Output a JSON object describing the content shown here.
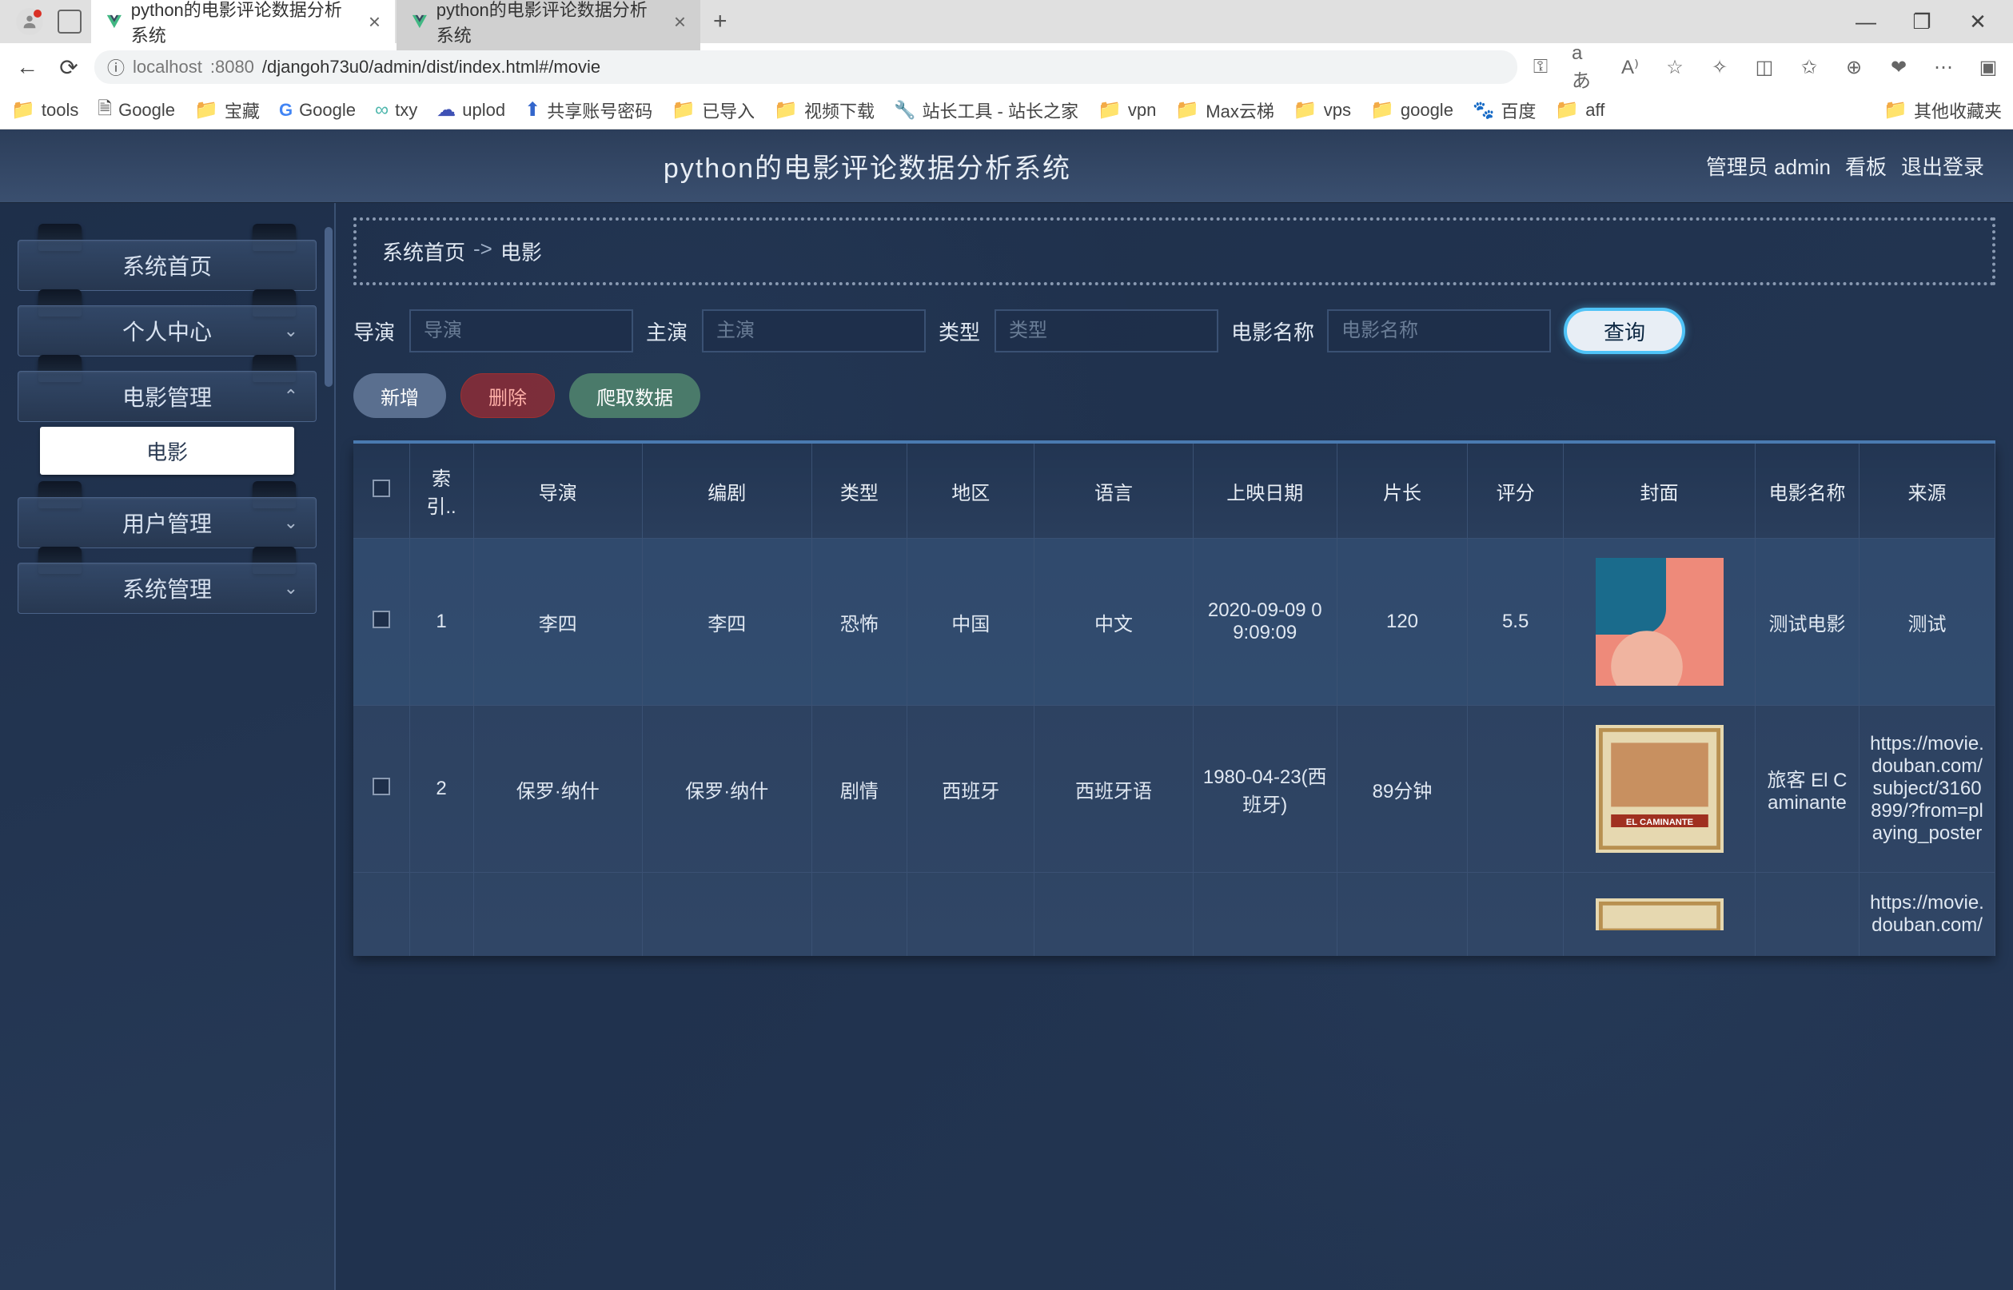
{
  "browser": {
    "tabs": [
      {
        "title": "python的电影评论数据分析系统",
        "active": true
      },
      {
        "title": "python的电影评论数据分析系统",
        "active": false
      }
    ],
    "url_host": "localhost",
    "url_port": ":8080",
    "url_path": "/djangoh73u0/admin/dist/index.html#/movie",
    "bookmarks": [
      "tools",
      "Google",
      "宝藏",
      "Google",
      "txy",
      "uplod",
      "共享账号密码",
      "已导入",
      "视频下载",
      "站长工具 - 站长之家",
      "vpn",
      "Max云梯",
      "vps",
      "google",
      "百度",
      "aff"
    ],
    "bookmark_right": "其他收藏夹"
  },
  "header": {
    "title": "python的电影评论数据分析系统",
    "user": "管理员 admin",
    "kanban": "看板",
    "logout": "退出登录"
  },
  "sidebar": {
    "home": "系统首页",
    "personal": "个人中心",
    "movie_mgr": "电影管理",
    "movie_sub": "电影",
    "user_mgr": "用户管理",
    "sys_mgr": "系统管理"
  },
  "breadcrumb": {
    "home": "系统首页",
    "current": "电影"
  },
  "filters": {
    "director": {
      "label": "导演",
      "placeholder": "导演"
    },
    "actor": {
      "label": "主演",
      "placeholder": "主演"
    },
    "type": {
      "label": "类型",
      "placeholder": "类型"
    },
    "name": {
      "label": "电影名称",
      "placeholder": "电影名称"
    },
    "query_btn": "查询"
  },
  "actions": {
    "add": "新增",
    "del": "删除",
    "crawl": "爬取数据"
  },
  "table": {
    "headers": [
      "索引..",
      "导演",
      "编剧",
      "类型",
      "地区",
      "语言",
      "上映日期",
      "片长",
      "评分",
      "封面",
      "电影名称",
      "来源"
    ],
    "rows": [
      {
        "idx": "1",
        "director": "李四",
        "writer": "李四",
        "type": "恐怖",
        "region": "中国",
        "lang": "中文",
        "date": "2020-09-09 09:09:09",
        "duration": "120",
        "rating": "5.5",
        "name": "测试电影",
        "source": "测试",
        "cover_style": "abstract"
      },
      {
        "idx": "2",
        "director": "保罗·纳什",
        "writer": "保罗·纳什",
        "type": "剧情",
        "region": "西班牙",
        "lang": "西班牙语",
        "date": "1980-04-23(西班牙)",
        "duration": "89分钟",
        "rating": "",
        "name": "旅客 El Caminante",
        "source": "https://movie.douban.com/subject/3160899/?from=playing_poster",
        "cover_style": "poster"
      },
      {
        "idx": "",
        "director": "",
        "writer": "",
        "type": "",
        "region": "",
        "lang": "",
        "date": "",
        "duration": "",
        "rating": "",
        "name": "",
        "source": "https://movie.douban.com/",
        "cover_style": "poster-partial"
      }
    ]
  }
}
